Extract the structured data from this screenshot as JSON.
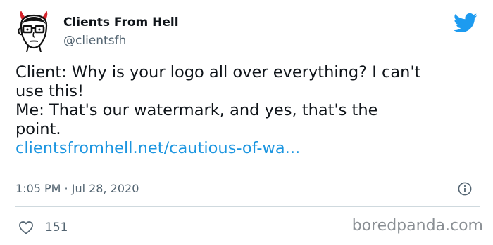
{
  "tweet": {
    "author_name": "Clients From Hell",
    "author_handle": "@clientsfh",
    "body_lines": [
      "Client: Why is your logo all over everything? I can't",
      "use this!",
      "Me: That's our watermark, and yes, that's the",
      "point."
    ],
    "link_text": "clientsfromhell.net/cautious-of-wa...",
    "timestamp": "1:05 PM · Jul 28, 2020",
    "like_count": "151",
    "icons": [
      "avatar-devil-face",
      "twitter-bird-icon",
      "info-icon",
      "heart-icon"
    ],
    "colors": {
      "link": "#1b95e0",
      "twitter_blue": "#1d9bf0",
      "text": "#0f1419",
      "muted": "#536471"
    }
  },
  "watermark": "boredpanda.com"
}
